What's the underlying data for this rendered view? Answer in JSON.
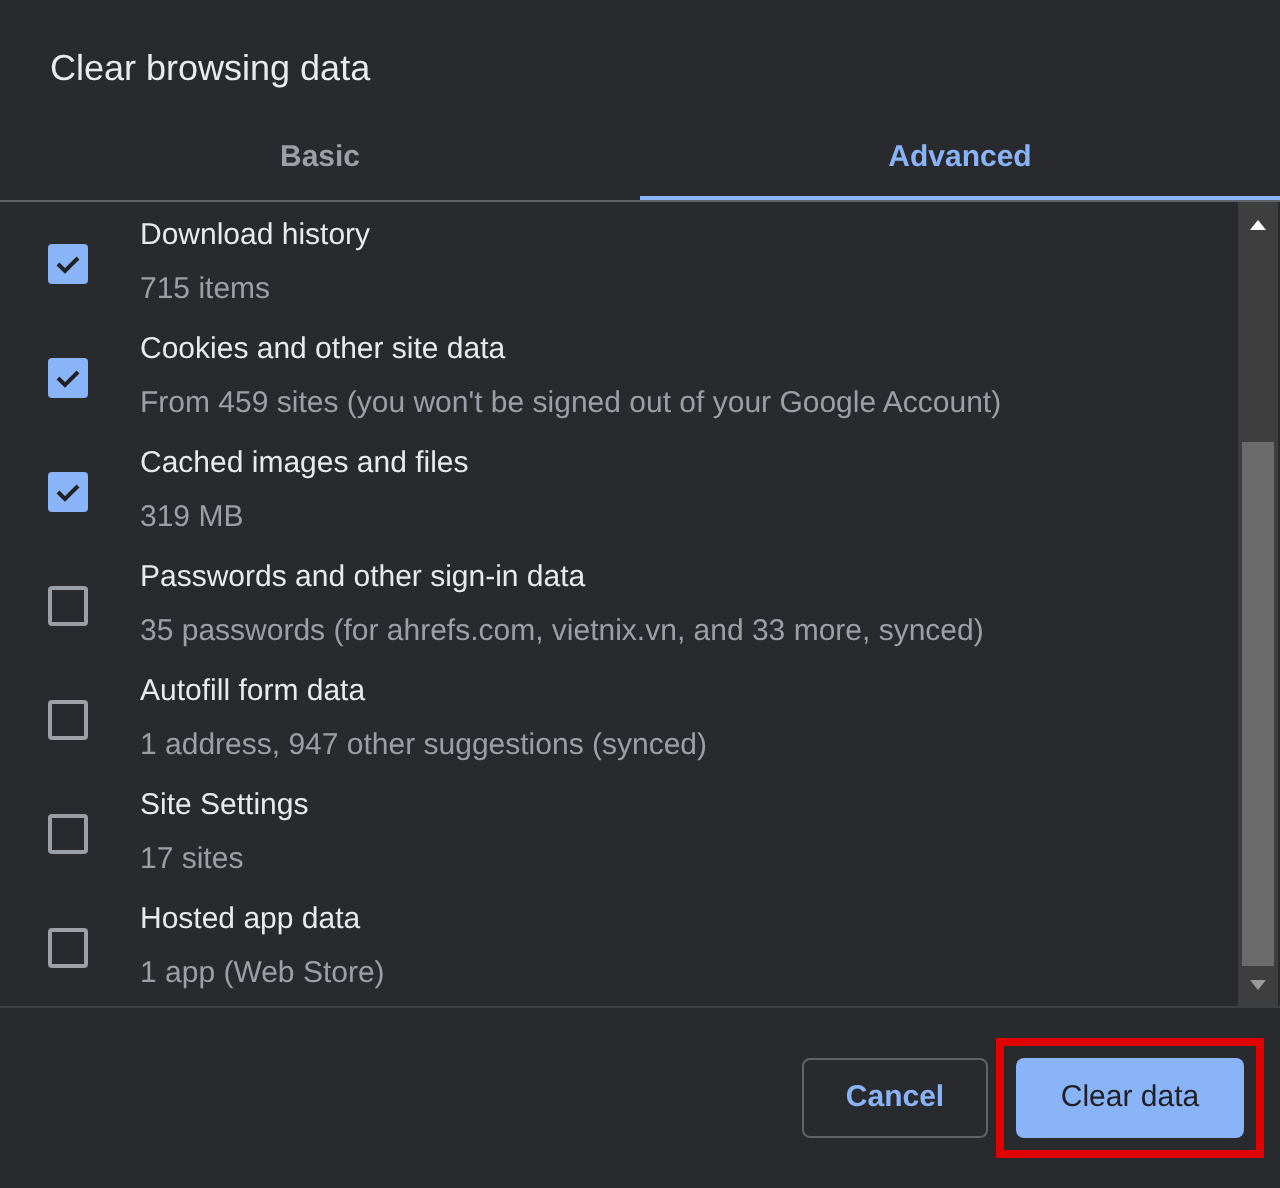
{
  "title": "Clear browsing data",
  "tabs": [
    {
      "label": "Basic",
      "selected": false
    },
    {
      "label": "Advanced",
      "selected": true
    }
  ],
  "items": [
    {
      "label": "Download history",
      "detail": "715 items",
      "checked": true
    },
    {
      "label": "Cookies and other site data",
      "detail": "From 459 sites (you won't be signed out of your Google Account)",
      "checked": true
    },
    {
      "label": "Cached images and files",
      "detail": "319 MB",
      "checked": true
    },
    {
      "label": "Passwords and other sign-in data",
      "detail": "35 passwords (for ahrefs.com, vietnix.vn, and 33 more, synced)",
      "checked": false
    },
    {
      "label": "Autofill form data",
      "detail": "1 address, 947 other suggestions (synced)",
      "checked": false
    },
    {
      "label": "Site Settings",
      "detail": "17 sites",
      "checked": false
    },
    {
      "label": "Hosted app data",
      "detail": "1 app (Web Store)",
      "checked": false
    }
  ],
  "buttons": {
    "cancel": "Cancel",
    "confirm": "Clear data"
  }
}
